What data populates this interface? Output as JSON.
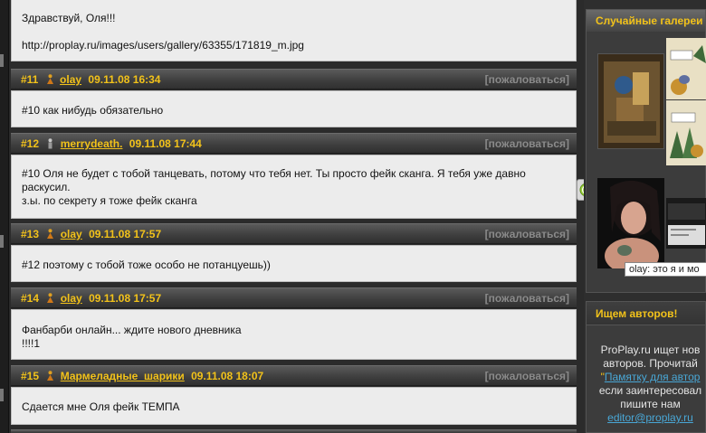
{
  "posts": [
    {
      "number": "",
      "user": "",
      "date": "",
      "report": "",
      "body_lines": [
        "Здравствуй, Оля!!!",
        "",
        "http://proplay.ru/images/users/gallery/63355/171819_m.jpg"
      ]
    },
    {
      "number": "#11",
      "user": "olay",
      "date": "09.11.08 16:34",
      "report": "[пожаловаться]",
      "gender": "female",
      "body_lines": [
        "#10 как нибудь обязательно"
      ]
    },
    {
      "number": "#12",
      "user": "merrydeath.",
      "date": "09.11.08 17:44",
      "report": "[пожаловаться]",
      "gender": "male",
      "body_lines": [
        "#10 Оля не будет с тобой танцевать, потому что тебя нет. Ты просто фейк сканга. Я тебя уже давно",
        "раскусил.",
        "з.ы. по секрету я тоже фейк сканга"
      ]
    },
    {
      "number": "#13",
      "user": "olay",
      "date": "09.11.08 17:57",
      "report": "[пожаловаться]",
      "gender": "female",
      "body_lines": [
        "#12 поэтому с тобой тоже особо не потанцуешь))"
      ]
    },
    {
      "number": "#14",
      "user": "olay",
      "date": "09.11.08 17:57",
      "report": "[пожаловаться]",
      "gender": "female",
      "body_lines": [
        "Фанбарби онлайн... ждите нового дневника",
        "!!!!1"
      ]
    },
    {
      "number": "#15",
      "user": "Мармеладные_шарики",
      "date": "09.11.08 18:07",
      "report": "[пожаловаться]",
      "gender": "female",
      "body_lines": [
        "Сдается мне Оля фейк ТЕМПА"
      ]
    }
  ],
  "sidebar": {
    "gallery_title": "Случайные галереи",
    "tooltip": "olay: это я и мо",
    "recruit_title": "Ищем авторов!",
    "recruit_line1": "ProPlay.ru ищет нов",
    "recruit_line2": "авторов. Прочитай",
    "recruit_quote_open": "\"",
    "recruit_link": "Памятку для автор",
    "recruit_line3": "если заинтересовал",
    "recruit_line4": "пишите нам",
    "recruit_email": "editor@proplay.ru"
  },
  "colors": {
    "accent": "#f2c21a",
    "link": "#49a7d6",
    "report": "#8a8a8a"
  }
}
